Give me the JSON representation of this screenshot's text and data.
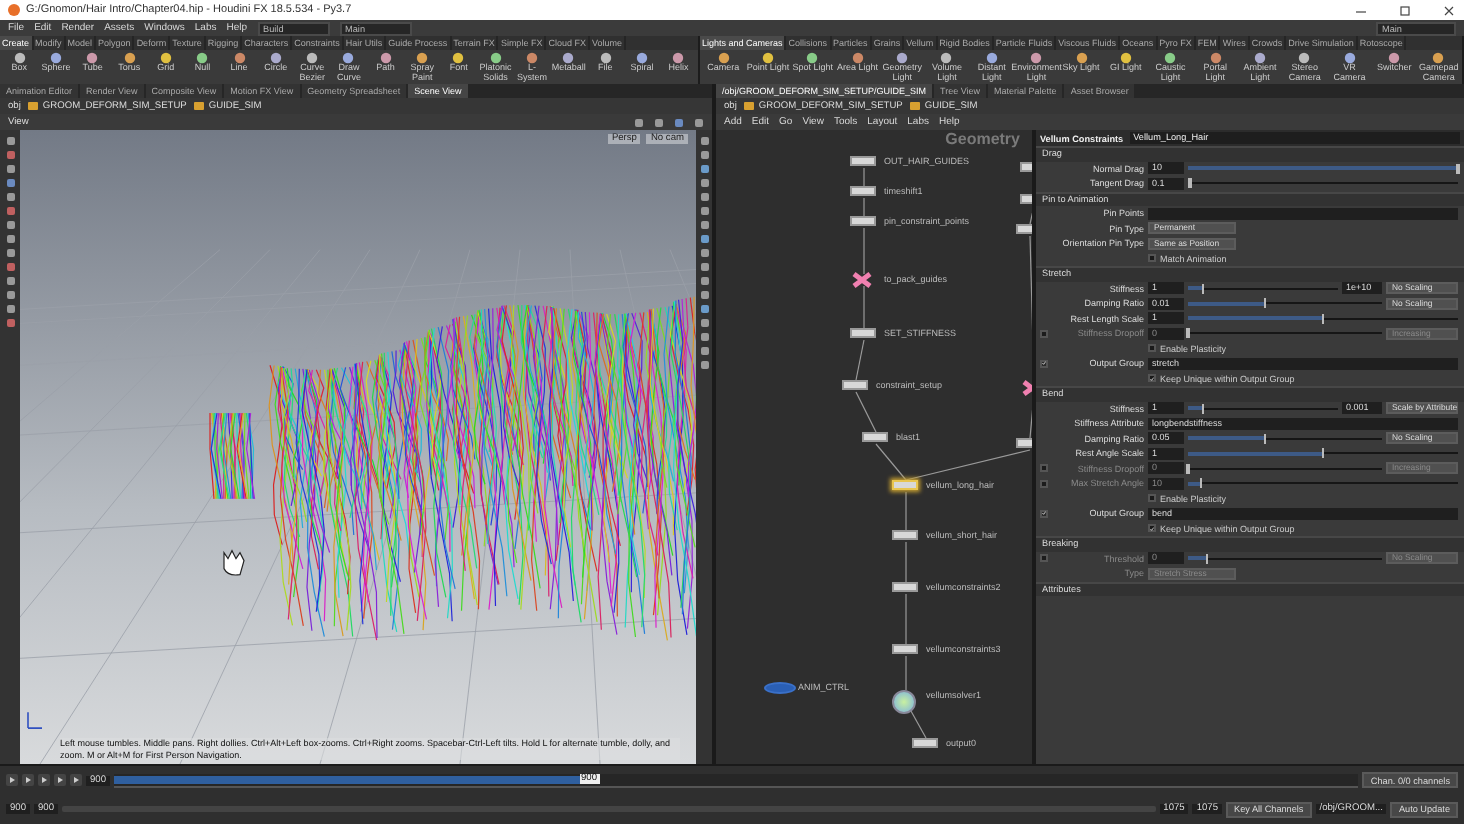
{
  "window": {
    "title": "G:/Gnomon/Hair Intro/Chapter04.hip - Houdini FX 18.5.534 - Py3.7"
  },
  "menu": {
    "items": [
      "File",
      "Edit",
      "Render",
      "Assets",
      "Windows",
      "Labs",
      "Help"
    ],
    "desktop": "Build",
    "context": "Main",
    "right_context": "Main"
  },
  "shelves": [
    {
      "tabs": [
        {
          "label": "Create",
          "selected": true
        },
        {
          "label": "Modify",
          "selected": false
        },
        {
          "label": "Model",
          "selected": false
        },
        {
          "label": "Polygon",
          "selected": false
        },
        {
          "label": "Deform",
          "selected": false
        },
        {
          "label": "Texture",
          "selected": false
        },
        {
          "label": "Rigging",
          "selected": false
        },
        {
          "label": "Characters",
          "selected": false
        },
        {
          "label": "Constraints",
          "selected": false
        },
        {
          "label": "Hair Utils",
          "selected": false
        },
        {
          "label": "Guide Process",
          "selected": false
        },
        {
          "label": "Terrain FX",
          "selected": false
        },
        {
          "label": "Simple FX",
          "selected": false
        },
        {
          "label": "Cloud FX",
          "selected": false
        },
        {
          "label": "Volume",
          "selected": false
        }
      ],
      "tools": [
        "Box",
        "Sphere",
        "Tube",
        "Torus",
        "Grid",
        "Null",
        "Line",
        "Circle",
        "Curve Bezier",
        "Draw Curve",
        "Path",
        "Spray Paint",
        "Font",
        "Platonic Solids",
        "L-System",
        "Metaball",
        "File",
        "Spiral",
        "Helix"
      ]
    },
    {
      "tabs": [
        {
          "label": "Lights and Cameras",
          "selected": true
        },
        {
          "label": "Collisions",
          "selected": false
        },
        {
          "label": "Particles",
          "selected": false
        },
        {
          "label": "Grains",
          "selected": false
        },
        {
          "label": "Vellum",
          "selected": false
        },
        {
          "label": "Rigid Bodies",
          "selected": false
        },
        {
          "label": "Particle Fluids",
          "selected": false
        },
        {
          "label": "Viscous Fluids",
          "selected": false
        },
        {
          "label": "Oceans",
          "selected": false
        },
        {
          "label": "Pyro FX",
          "selected": false
        },
        {
          "label": "FEM",
          "selected": false
        },
        {
          "label": "Wires",
          "selected": false
        },
        {
          "label": "Crowds",
          "selected": false
        },
        {
          "label": "Drive Simulation",
          "selected": false
        },
        {
          "label": "Rotoscope",
          "selected": false
        }
      ],
      "tools": [
        "Camera",
        "Point Light",
        "Spot Light",
        "Area Light",
        "Geometry Light",
        "Volume Light",
        "Distant Light",
        "Environment Light",
        "Sky Light",
        "GI Light",
        "Caustic Light",
        "Portal Light",
        "Ambient Light",
        "Stereo Camera",
        "VR Camera",
        "Switcher",
        "Gamepad Camera"
      ]
    }
  ],
  "left_pane": {
    "tabs": [
      {
        "label": "Animation Editor",
        "selected": false
      },
      {
        "label": "Render View",
        "selected": false
      },
      {
        "label": "Composite View",
        "selected": false
      },
      {
        "label": "Motion FX View",
        "selected": false
      },
      {
        "label": "Geometry Spreadsheet",
        "selected": false
      },
      {
        "label": "Scene View",
        "selected": true
      }
    ],
    "path": [
      "obj",
      "GROOM_DEFORM_SIM_SETUP",
      "GUIDE_SIM"
    ],
    "view_label": "View",
    "camera": "Persp",
    "display": "No cam",
    "status": "Left mouse tumbles. Middle pans. Right dollies. Ctrl+Alt+Left box-zooms. Ctrl+Right zooms. Spacebar-Ctrl-Left tilts. Hold L for alternate tumble, dolly, and zoom.    M or Alt+M for First Person Navigation."
  },
  "right_pane": {
    "tabs": [
      {
        "label": "/obj/GROOM_DEFORM_SIM_SETUP/GUIDE_SIM",
        "selected": true
      },
      {
        "label": "Tree View",
        "selected": false
      },
      {
        "label": "Material Palette",
        "selected": false
      },
      {
        "label": "Asset Browser",
        "selected": false
      }
    ],
    "path": [
      "obj",
      "GROOM_DEFORM_SIM_SETUP",
      "GUIDE_SIM"
    ],
    "menu": [
      "Add",
      "Edit",
      "Go",
      "View",
      "Tools",
      "Layout",
      "Labs",
      "Help"
    ],
    "context_label": "Geometry",
    "nodes": [
      {
        "kind": "box",
        "label": "OUT_HAIR_GUIDES",
        "selected": false
      },
      {
        "kind": "box",
        "label": "timeshift1",
        "selected": false
      },
      {
        "kind": "box",
        "label": "pin_constraint_points",
        "selected": false
      },
      {
        "kind": "cross",
        "label": "to_pack_guides",
        "selected": false
      },
      {
        "kind": "box",
        "label": "SET_STIFFNESS",
        "selected": false
      },
      {
        "kind": "box",
        "label": "constraint_setup",
        "selected": false
      },
      {
        "kind": "box",
        "label": "blast1",
        "selected": false
      },
      {
        "kind": "box",
        "label": "vellum_long_hair",
        "selected": true
      },
      {
        "kind": "box",
        "label": "vellum_short_hair",
        "selected": false
      },
      {
        "kind": "box",
        "label": "vellumconstraints2",
        "selected": false
      },
      {
        "kind": "box",
        "label": "vellumconstraints3",
        "selected": false
      },
      {
        "kind": "solver",
        "label": "vellumsolver1",
        "selected": false
      },
      {
        "kind": "box",
        "label": "output0",
        "selected": false
      },
      {
        "kind": "blob",
        "label": "ANIM_CTRL",
        "selected": false
      },
      {
        "kind": "box",
        "selected": false
      },
      {
        "kind": "box",
        "selected": false
      },
      {
        "kind": "box",
        "selected": false
      },
      {
        "kind": "cross",
        "selected": false
      },
      {
        "kind": "box",
        "selected": false
      }
    ]
  },
  "parameters": {
    "type": "Vellum Constraints",
    "name": "Vellum_Long_Hair",
    "rows": [
      {
        "kind": "section",
        "label": "Drag"
      },
      {
        "kind": "slider",
        "label": "Normal Drag",
        "value": "10",
        "level": 1
      },
      {
        "kind": "slider",
        "label": "Tangent Drag",
        "value": "0.1",
        "level": 0.01
      },
      {
        "kind": "section",
        "label": "Pin to Animation"
      },
      {
        "kind": "field",
        "label": "Pin Points"
      },
      {
        "kind": "menu",
        "label": "Pin Type",
        "value": "Permanent"
      },
      {
        "kind": "menu",
        "label": "Orientation Pin Type",
        "value": "Same as Position"
      },
      {
        "kind": "check",
        "label": "Match Animation",
        "checked": false
      },
      {
        "kind": "section",
        "label": "Stretch"
      },
      {
        "kind": "slider",
        "label": "Stiffness",
        "value": "1",
        "level": 0.1,
        "extra": "1e+10",
        "menu": "No Scaling"
      },
      {
        "kind": "slider",
        "label": "Damping Ratio",
        "value": "0.01",
        "level": 0.4,
        "menu": "No Scaling"
      },
      {
        "kind": "slider",
        "label": "Rest Length Scale",
        "value": "1",
        "level": 0.5
      },
      {
        "kind": "slider",
        "label": "Stiffness Dropoff",
        "value": "0",
        "level": 0,
        "menu": "Increasing",
        "toggle": false,
        "disabled": true
      },
      {
        "kind": "check",
        "label": "Enable Plasticity",
        "checked": false
      },
      {
        "kind": "field",
        "label": "Output Group",
        "value": "stretch",
        "toggle": true
      },
      {
        "kind": "check",
        "label": "Keep Unique within Output Group",
        "checked": true
      },
      {
        "kind": "section",
        "label": "Bend"
      },
      {
        "kind": "slider",
        "label": "Stiffness",
        "value": "1",
        "level": 0.1,
        "extra": "0.001",
        "menu": "Scale by Attribute"
      },
      {
        "kind": "field",
        "label": "Stiffness Attribute",
        "value": "longbendstiffness"
      },
      {
        "kind": "slider",
        "label": "Damping Ratio",
        "value": "0.05",
        "level": 0.4,
        "menu": "No Scaling"
      },
      {
        "kind": "slider",
        "label": "Rest Angle Scale",
        "value": "1",
        "level": 0.5
      },
      {
        "kind": "slider",
        "label": "Stiffness Dropoff",
        "value": "0",
        "level": 0,
        "menu": "Increasing",
        "toggle": false,
        "disabled": true
      },
      {
        "kind": "slider",
        "label": "Max Stretch Angle",
        "value": "10",
        "level": 0.05,
        "toggle": false,
        "disabled": true
      },
      {
        "kind": "check",
        "label": "Enable Plasticity",
        "checked": false
      },
      {
        "kind": "field",
        "label": "Output Group",
        "value": "bend",
        "toggle": true
      },
      {
        "kind": "check",
        "label": "Keep Unique within Output Group",
        "checked": true
      },
      {
        "kind": "section",
        "label": "Breaking"
      },
      {
        "kind": "slider",
        "label": "Threshold",
        "value": "0",
        "level": 0.1,
        "menu": "No Scaling",
        "toggle": false,
        "disabled": true
      },
      {
        "kind": "menu",
        "label": "Type",
        "value": "Stretch Stress",
        "disabled": true
      },
      {
        "kind": "section",
        "label": "Attributes"
      }
    ]
  },
  "timeline": {
    "frame": "900",
    "playhead": "900",
    "cache": {
      "level": 0.38
    },
    "start": "900",
    "start_sub": "900",
    "end": "1075",
    "end_sub": "1075",
    "buttons": [
      "Chan. 0/0 channels",
      "Key All Channels"
    ],
    "node_path": "/obj/GROOM...",
    "update": "Auto Update"
  }
}
